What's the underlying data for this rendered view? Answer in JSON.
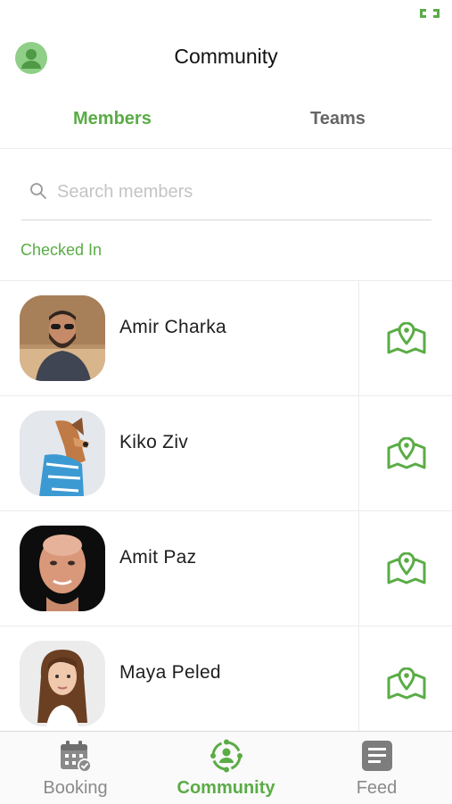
{
  "header": {
    "title": "Community"
  },
  "tabs": [
    {
      "label": "Members",
      "active": true
    },
    {
      "label": "Teams",
      "active": false
    }
  ],
  "search": {
    "placeholder": "Search members",
    "value": ""
  },
  "section": {
    "label": "Checked In"
  },
  "members": [
    {
      "name": "Amir Charka",
      "avatar": "photo-man-beard-sunglasses"
    },
    {
      "name": "Kiko Ziv",
      "avatar": "photo-dog"
    },
    {
      "name": "Amit Paz",
      "avatar": "photo-man-bald"
    },
    {
      "name": "Maya Peled",
      "avatar": "photo-woman"
    }
  ],
  "bottom_nav": [
    {
      "label": "Booking",
      "icon": "calendar-check-icon",
      "active": false
    },
    {
      "label": "Community",
      "icon": "community-icon",
      "active": true
    },
    {
      "label": "Feed",
      "icon": "feed-icon",
      "active": false
    }
  ],
  "colors": {
    "accent": "#5aac46",
    "inactive": "#8a8a8a"
  }
}
